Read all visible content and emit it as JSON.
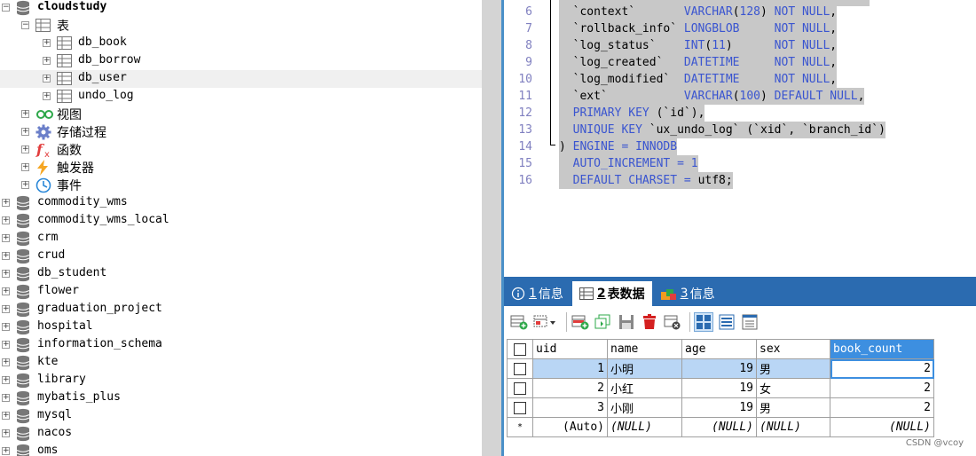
{
  "tree": {
    "db_active": "cloudstudy",
    "tables_folder": "表",
    "tables": [
      "db_book",
      "db_borrow",
      "db_user",
      "undo_log"
    ],
    "selected_table": "db_user",
    "folders": [
      "视图",
      "存储过程",
      "函数",
      "触发器",
      "事件"
    ],
    "databases": [
      "commodity_wms",
      "commodity_wms_local",
      "crm",
      "crud",
      "db_student",
      "flower",
      "graduation_project",
      "hospital",
      "information_schema",
      "kte",
      "library",
      "mybatis_plus",
      "mysql",
      "nacos",
      "oms"
    ]
  },
  "editor": {
    "lines": [
      {
        "n": "6",
        "t": "  `context`       VARCHAR(128) NOT NULL,"
      },
      {
        "n": "7",
        "t": "  `rollback_info` LONGBLOB     NOT NULL,"
      },
      {
        "n": "8",
        "t": "  `log_status`    INT(11)      NOT NULL,"
      },
      {
        "n": "9",
        "t": "  `log_created`   DATETIME     NOT NULL,"
      },
      {
        "n": "10",
        "t": "  `log_modified`  DATETIME     NOT NULL,"
      },
      {
        "n": "11",
        "t": "  `ext`           VARCHAR(100) DEFAULT NULL,"
      },
      {
        "n": "12",
        "t": "  PRIMARY KEY (`id`),"
      },
      {
        "n": "13",
        "t": "  UNIQUE KEY `ux_undo_log` (`xid`, `branch_id`)"
      },
      {
        "n": "14",
        "t": ") ENGINE = INNODB"
      },
      {
        "n": "15",
        "t": "  AUTO_INCREMENT = 1"
      },
      {
        "n": "16",
        "t": "  DEFAULT CHARSET = utf8;"
      }
    ]
  },
  "tabs": [
    {
      "num": "1",
      "label": "信息"
    },
    {
      "num": "2",
      "label": "表数据"
    },
    {
      "num": "3",
      "label": "信息"
    }
  ],
  "grid": {
    "columns": [
      "uid",
      "name",
      "age",
      "sex",
      "book_count"
    ],
    "rows": [
      [
        "1",
        "小明",
        "19",
        "男",
        "2"
      ],
      [
        "2",
        "小红",
        "19",
        "女",
        "2"
      ],
      [
        "3",
        "小刚",
        "19",
        "男",
        "2"
      ]
    ],
    "new_row": [
      "(Auto)",
      "(NULL)",
      "(NULL)",
      "(NULL)",
      "(NULL)"
    ],
    "new_row_marker": "*"
  },
  "watermark": "CSDN @vcoy"
}
